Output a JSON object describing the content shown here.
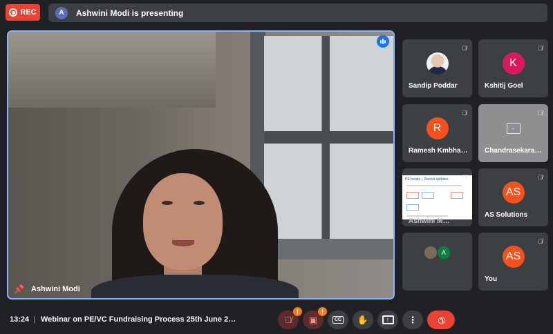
{
  "header": {
    "rec_label": "REC",
    "presenter_initial": "A",
    "presenting_text": "Ashwini Modi is presenting"
  },
  "main_video": {
    "participant_name": "Ashwini Modi"
  },
  "participants": [
    {
      "name": "Sandip Poddar"
    },
    {
      "name": "Kshitij Goel",
      "initial": "K"
    },
    {
      "name": "Ramesh Kmbha…",
      "initial": "R"
    },
    {
      "name": "Chandrasekara…"
    },
    {
      "name": "Ashwini M…",
      "slide_title": "PE trends – Recent updates"
    },
    {
      "name": "AS Solutions",
      "initial": "AS"
    },
    {
      "initial": "A"
    },
    {
      "name": "You",
      "initial": "AS"
    }
  ],
  "bottom_bar": {
    "time": "13:24",
    "separator": "|",
    "meeting_title": "Webinar on PE/VC Fundraising Process 25th June 2…",
    "mic_badge": "!",
    "camera_badge": "!",
    "cc_label": "CC"
  },
  "colors": {
    "background": "#202124",
    "tile": "#3c4043",
    "rec": "#ea4335",
    "active_speaker_border": "#8ab4f8",
    "avatar_orange": "#f4511e",
    "avatar_magenta": "#d81b60",
    "end_call": "#ea4335"
  }
}
